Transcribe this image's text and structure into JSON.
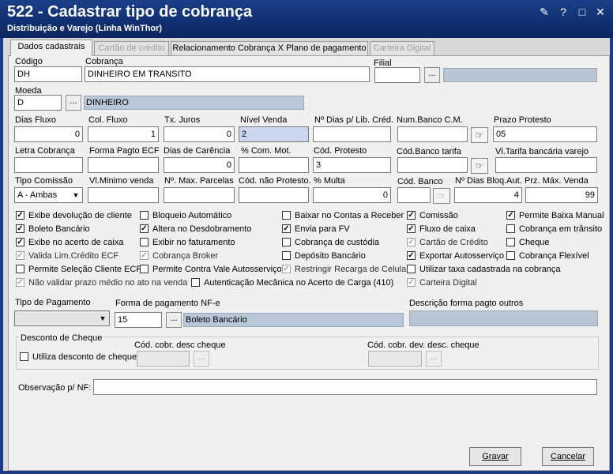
{
  "window": {
    "title": "522 - Cadastrar tipo de cobrança",
    "subtitle": "Distribuição e Varejo (Linha WinThor)"
  },
  "tabs": [
    {
      "label": "Dados cadastrais",
      "state": "active"
    },
    {
      "label": "Cartão de crédito",
      "state": "disabled"
    },
    {
      "label": "Relacionamento Cobrança X Plano de pagamento",
      "state": "normal"
    },
    {
      "label": "Carteira Digital",
      "state": "disabled"
    }
  ],
  "labels": {
    "codigo": "Código",
    "cobranca": "Cobrança",
    "filial": "Filial",
    "moeda": "Moeda",
    "dias_fluxo": "Dias Fluxo",
    "col_fluxo": "Col. Fluxo",
    "tx_juros": "Tx. Juros",
    "nivel_venda": "Nível Venda",
    "dias_lib": "Nº Dias p/ Lib. Créd.",
    "num_banco": "Num.Banco C.M.",
    "prazo_protesto": "Prazo Protesto",
    "letra_cobranca": "Letra Cobrança",
    "forma_pagto_ecf": "Forma Pagto ECF",
    "dias_carencia": "Dias de Carência",
    "com_mot": "% Com. Mot.",
    "cod_protesto": "Cód. Protesto",
    "cod_banco_tarifa": "Cód.Banco tarifa",
    "vl_tarifa": "Vl.Tarifa bancária varejo",
    "tipo_comissao": "Tipo Comissão",
    "vl_minimo": "Vl.Minimo venda",
    "max_parcelas": "Nº. Max. Parcelas",
    "cod_nao_protesto": "Cód. não Protesto.",
    "multa": "% Multa",
    "cod_banco": "Cód. Banco",
    "dias_bloq": "Nº Dias Bloq.Aut.",
    "prz_max": "Prz. Máx. Venda",
    "tipo_pagamento": "Tipo de Pagamento",
    "forma_pag_nfe": "Forma de pagamento NF-e",
    "desc_outros": "Descrição forma pagto outros",
    "desconto_cheque": "Desconto de Cheque",
    "cod_desc_cheque": "Cód. cobr. desc cheque",
    "cod_dev_desc_cheque": "Cód. cobr. dev. desc. cheque",
    "observacao": "Observação p/ NF:"
  },
  "values": {
    "codigo": "DH",
    "cobranca": "DINHEIRO EM TRANSITO",
    "filial": "",
    "filial_desc": "",
    "moeda": "D",
    "moeda_desc": "DINHEIRO",
    "dias_fluxo": "0",
    "col_fluxo": "1",
    "tx_juros": "0",
    "nivel_venda": "2",
    "dias_lib": "",
    "num_banco": "",
    "prazo_protesto": "05",
    "letra_cobranca": "",
    "forma_pagto_ecf": "",
    "dias_carencia": "0",
    "com_mot": "",
    "cod_protesto": "3",
    "cod_banco_tarifa": "",
    "vl_tarifa": "",
    "tipo_comissao": "A - Ambas",
    "vl_minimo": "",
    "max_parcelas": "",
    "cod_nao_protesto": "",
    "multa": "0",
    "cod_banco": "",
    "dias_bloq": "4",
    "prz_max": "99",
    "tipo_pagamento": "",
    "forma_pag_nfe": "15",
    "forma_pag_nfe_desc": "Boleto Bancário",
    "desc_outros": "",
    "cod_desc_cheque": "",
    "cod_dev_desc_cheque": "",
    "observacao": ""
  },
  "ellipsis": "...",
  "checkboxes": [
    {
      "label": "Exibe devolução de cliente",
      "checked": true,
      "enabled": true
    },
    {
      "label": "Boleto Bancário",
      "checked": true,
      "enabled": true
    },
    {
      "label": "Exibe no acerto de caixa",
      "checked": true,
      "enabled": true
    },
    {
      "label": "Valida Lim.Crédito ECF",
      "checked": true,
      "enabled": false
    },
    {
      "label": "Permite Seleção Cliente ECF",
      "checked": false,
      "enabled": true
    },
    {
      "label": "Não validar prazo médio no ato na venda",
      "checked": true,
      "enabled": false
    },
    {
      "label": "Bloqueio Automático",
      "checked": false,
      "enabled": true
    },
    {
      "label": "Altera no Desdobramento",
      "checked": true,
      "enabled": true
    },
    {
      "label": "Exibir no faturamento",
      "checked": false,
      "enabled": true
    },
    {
      "label": "Cobrança Broker",
      "checked": true,
      "enabled": false
    },
    {
      "label": "Permite Contra Vale Autosserviço",
      "checked": false,
      "enabled": true
    },
    {
      "label": "Autenticação Mecânica no Acerto de Carga (410)",
      "checked": false,
      "enabled": true
    },
    {
      "label": "Baixar no Contas a Receber",
      "checked": false,
      "enabled": true
    },
    {
      "label": "Envia para FV",
      "checked": true,
      "enabled": true
    },
    {
      "label": "Cobrança de custódia",
      "checked": false,
      "enabled": true
    },
    {
      "label": "Depósito Bancário",
      "checked": false,
      "enabled": true
    },
    {
      "label": "Restringir Recarga de Celular",
      "checked": true,
      "enabled": false
    },
    {
      "label": "Comissão",
      "checked": true,
      "enabled": true
    },
    {
      "label": "Fluxo de caixa",
      "checked": true,
      "enabled": true
    },
    {
      "label": "Cartão de Crédito",
      "checked": true,
      "enabled": false
    },
    {
      "label": "Exportar Autosserviço",
      "checked": true,
      "enabled": true
    },
    {
      "label": "Utilizar taxa cadastrada na cobrança",
      "checked": false,
      "enabled": true
    },
    {
      "label": "Carteira Digital",
      "checked": true,
      "enabled": false
    },
    {
      "label": "Permite Baixa Manual",
      "checked": true,
      "enabled": true
    },
    {
      "label": "Cobrança em trânsito",
      "checked": false,
      "enabled": true
    },
    {
      "label": "Cheque",
      "checked": false,
      "enabled": true
    },
    {
      "label": "Cobrança Flexível",
      "checked": false,
      "enabled": true
    },
    {
      "label": "Utiliza desconto de cheque",
      "checked": false,
      "enabled": true
    }
  ],
  "buttons": {
    "gravar": "Gravar",
    "cancelar": "Cancelar"
  }
}
